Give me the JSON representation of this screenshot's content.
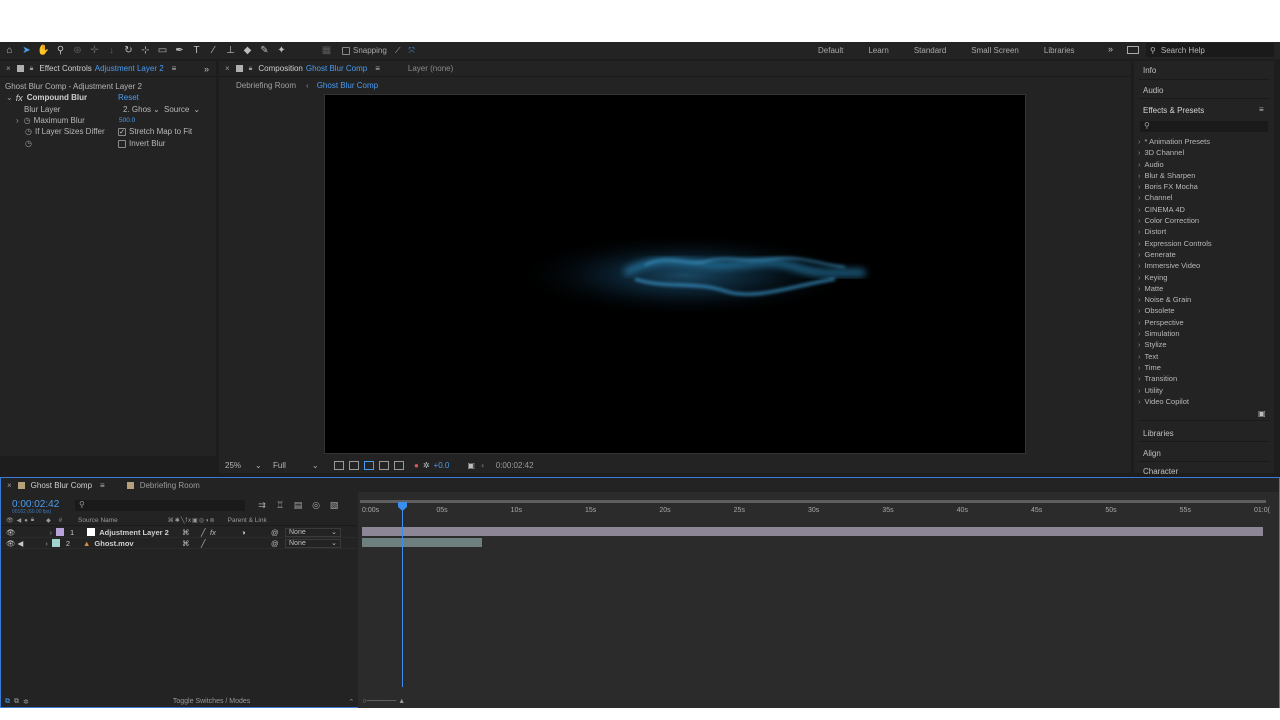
{
  "toolbar": {
    "snapping_label": "Snapping",
    "workspaces": [
      "Default",
      "Learn",
      "Standard",
      "Small Screen",
      "Libraries"
    ],
    "more": "»",
    "search_placeholder": "Search Help"
  },
  "effect_controls": {
    "tab_label": "Effect Controls",
    "tab_target": "Adjustment Layer 2",
    "subtitle": "Ghost Blur Comp - Adjustment Layer 2",
    "effect_name": "Compound Blur",
    "reset": "Reset",
    "rows": [
      {
        "label": "Blur Layer",
        "value": "2. Ghos",
        "extra": "Source"
      },
      {
        "label": "Maximum Blur",
        "value": "500.0"
      },
      {
        "label": "If Layer Sizes Differ",
        "value": "Stretch Map to Fit"
      },
      {
        "label": "",
        "value": "Invert Blur"
      }
    ]
  },
  "composition": {
    "tab_label": "Composition",
    "tab_target": "Ghost Blur Comp",
    "layer_tab": "Layer (none)",
    "breadcrumbs": [
      "Debriefing Room",
      "Ghost Blur Comp"
    ],
    "zoom": "25%",
    "resolution": "Full",
    "exposure": "+0.0",
    "timecode": "0:00:02:42"
  },
  "right_panel": {
    "info": "Info",
    "audio": "Audio",
    "effects_presets": "Effects & Presets",
    "categories": [
      "* Animation Presets",
      "3D Channel",
      "Audio",
      "Blur & Sharpen",
      "Boris FX Mocha",
      "Channel",
      "CINEMA 4D",
      "Color Correction",
      "Distort",
      "Expression Controls",
      "Generate",
      "Immersive Video",
      "Keying",
      "Matte",
      "Noise & Grain",
      "Obsolete",
      "Perspective",
      "Simulation",
      "Stylize",
      "Text",
      "Time",
      "Transition",
      "Utility",
      "Video Copilot"
    ],
    "libraries": "Libraries",
    "align": "Align",
    "character": "Character"
  },
  "timeline": {
    "tabs": [
      "Ghost Blur Comp",
      "Debriefing Room"
    ],
    "timecode": "0:00:02:42",
    "frame_info": "00162 (60.00 fps)",
    "col_source_name": "Source Name",
    "col_parent": "Parent & Link",
    "layers": [
      {
        "num": "1",
        "name": "Adjustment Layer 2",
        "parent": "None",
        "color": "#b7a3d9"
      },
      {
        "num": "2",
        "name": "Ghost.mov",
        "parent": "None",
        "color": "#9fd4d0"
      }
    ],
    "ruler": [
      "0:00s",
      "05s",
      "10s",
      "15s",
      "20s",
      "25s",
      "30s",
      "35s",
      "40s",
      "45s",
      "50s",
      "55s",
      "01:0("
    ],
    "toggle_label": "Toggle Switches / Modes"
  },
  "colors": {
    "accent": "#4a9cf0",
    "layer1_track": "#8c8697",
    "layer2_track": "#6d807f"
  }
}
